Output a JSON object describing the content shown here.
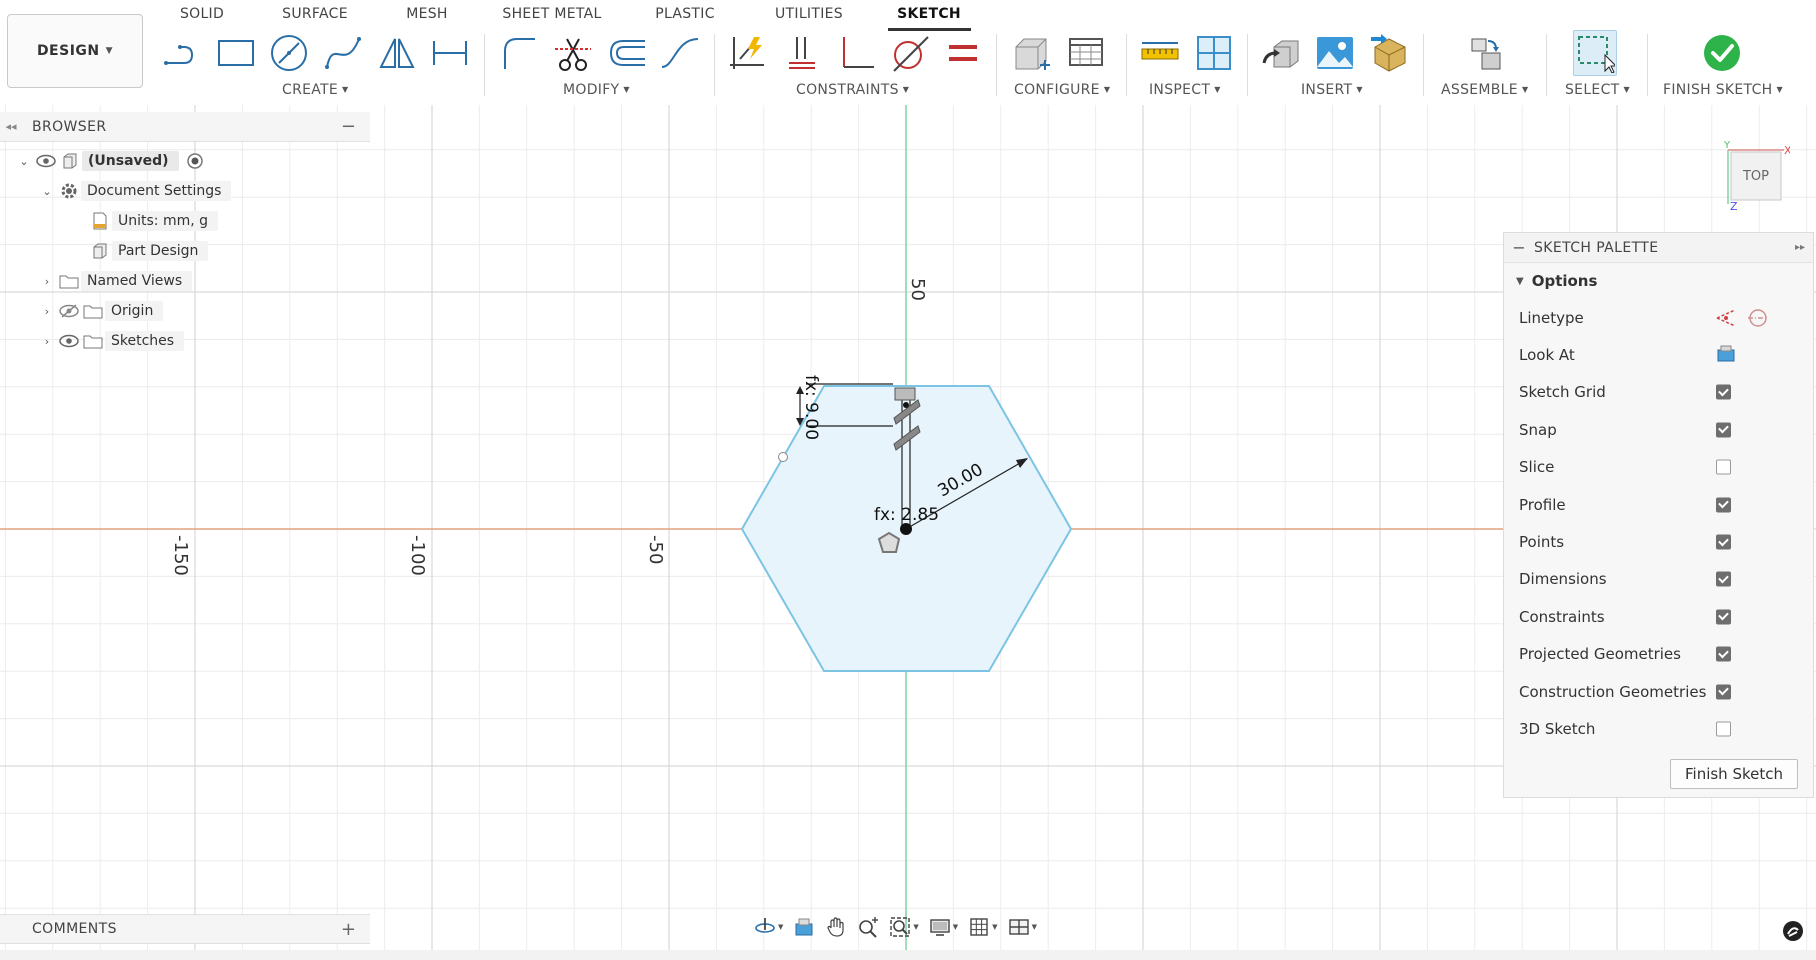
{
  "workspace": {
    "label": "DESIGN"
  },
  "tabs": [
    {
      "label": "SOLID",
      "active": false
    },
    {
      "label": "SURFACE",
      "active": false
    },
    {
      "label": "MESH",
      "active": false
    },
    {
      "label": "SHEET METAL",
      "active": false
    },
    {
      "label": "PLASTIC",
      "active": false
    },
    {
      "label": "UTILITIES",
      "active": false
    },
    {
      "label": "SKETCH",
      "active": true
    }
  ],
  "groups": {
    "create": "CREATE",
    "modify": "MODIFY",
    "constraints": "CONSTRAINTS",
    "configure": "CONFIGURE",
    "inspect": "INSPECT",
    "insert": "INSERT",
    "assemble": "ASSEMBLE",
    "select": "SELECT",
    "finish": "FINISH SKETCH"
  },
  "tools": {
    "create": [
      "line-icon",
      "rectangle-icon",
      "circle-icon",
      "spline-icon",
      "mirror-icon",
      "dimension-icon"
    ],
    "modify": [
      "fillet-icon",
      "trim-icon",
      "offset-icon",
      "curve-icon"
    ],
    "constraints": [
      "auto-constrain-icon",
      "vertical-horizontal-icon",
      "perpendicular-icon",
      "tangent-icon",
      "equal-icon"
    ],
    "configure": [
      "parameters-box-icon",
      "configuration-table-icon"
    ],
    "inspect": [
      "measure-icon",
      "section-analysis-icon"
    ],
    "insert": [
      "insert-derive-icon",
      "canvas-image-icon",
      "insert-mesh-icon"
    ],
    "assemble": [
      "assemble-icon"
    ],
    "select": [
      "select-window-icon"
    ],
    "finish": [
      "finish-sketch-check-icon"
    ]
  },
  "browser": {
    "title": "BROWSER",
    "items": [
      {
        "label": "(Unsaved)",
        "icon": "component-icon"
      },
      {
        "label": "Document Settings",
        "icon": "gear-icon"
      },
      {
        "label": "Units: mm, g",
        "icon": "units-icon"
      },
      {
        "label": "Part Design",
        "icon": "part-design-icon"
      },
      {
        "label": "Named Views",
        "icon": "folder-icon"
      },
      {
        "label": "Origin",
        "icon": "folder-icon"
      },
      {
        "label": "Sketches",
        "icon": "folder-icon"
      }
    ]
  },
  "comments": {
    "title": "COMMENTS"
  },
  "canvas": {
    "axis_labels": [
      "50",
      "-150",
      "-100",
      "-50"
    ],
    "dimensions": {
      "vertical": "fx: 9.00",
      "offset": "fx: 2.85",
      "radius": "30.00"
    }
  },
  "viewcube": {
    "label": "TOP",
    "x": "X",
    "y": "Y",
    "z": "Z"
  },
  "palette": {
    "title": "SKETCH PALETTE",
    "section": "Options",
    "options": [
      {
        "label": "Linetype",
        "type": "icons"
      },
      {
        "label": "Look At",
        "type": "icon"
      },
      {
        "label": "Sketch Grid",
        "checked": true
      },
      {
        "label": "Snap",
        "checked": true
      },
      {
        "label": "Slice",
        "checked": false
      },
      {
        "label": "Profile",
        "checked": true
      },
      {
        "label": "Points",
        "checked": true
      },
      {
        "label": "Dimensions",
        "checked": true
      },
      {
        "label": "Constraints",
        "checked": true
      },
      {
        "label": "Projected Geometries",
        "checked": true
      },
      {
        "label": "Construction Geometries",
        "checked": true
      },
      {
        "label": "3D Sketch",
        "checked": false
      }
    ],
    "finish_button": "Finish Sketch"
  },
  "navbar": [
    "orbit-icon",
    "look-at-icon",
    "pan-icon",
    "zoom-icon",
    "fit-icon",
    "display-settings-icon",
    "grid-icon",
    "viewports-icon"
  ],
  "colors": {
    "accent": "#00a6e0",
    "profile_fill": "#e8f4fc",
    "profile_stroke": "#7cc4e4",
    "x_axis": "#e0a080",
    "y_axis": "#7ed4a0",
    "finish_green": "#2db34a"
  }
}
